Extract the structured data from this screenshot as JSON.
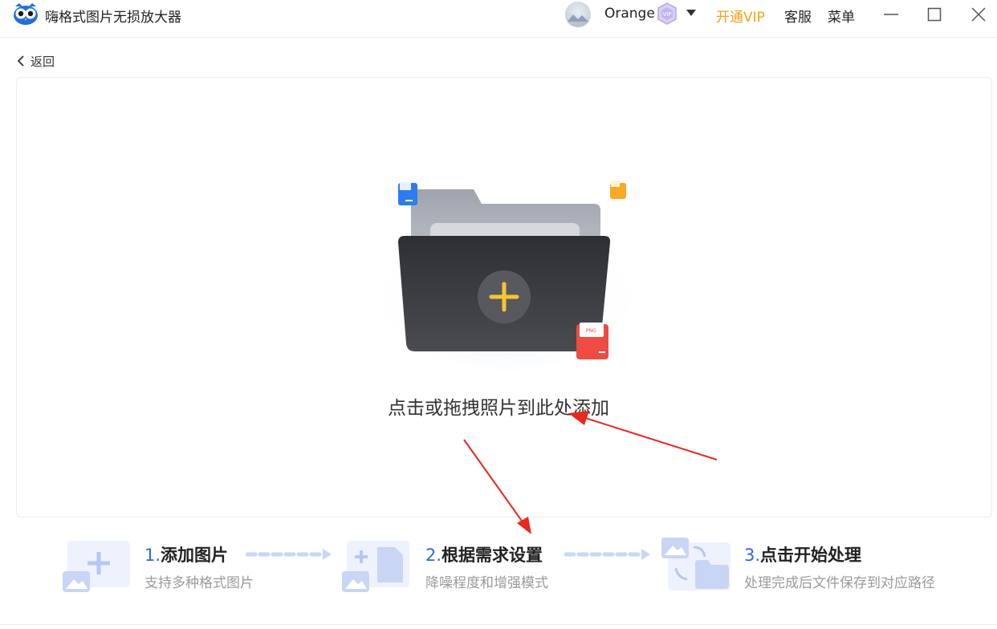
{
  "app": {
    "title": "嗨格式图片无损放大器"
  },
  "header": {
    "username": "Orange",
    "open_vip": "开通VIP",
    "customer_service": "客服",
    "menu": "菜单"
  },
  "nav": {
    "back": "返回"
  },
  "dropzone": {
    "prompt": "点击或拖拽照片到此处添加"
  },
  "steps": [
    {
      "number": "1.",
      "title": "添加图片",
      "desc": "支持多种格式图片"
    },
    {
      "number": "2.",
      "title": "根据需求设置",
      "desc": "降噪程度和增强模式"
    },
    {
      "number": "3.",
      "title": "点击开始处理",
      "desc": "处理完成后文件保存到对应路径"
    }
  ],
  "colors": {
    "accent_blue": "#2e67e8",
    "vip_orange": "#f5a11a",
    "plus_yellow": "#f7c531",
    "annotation_red": "#e8291c"
  }
}
